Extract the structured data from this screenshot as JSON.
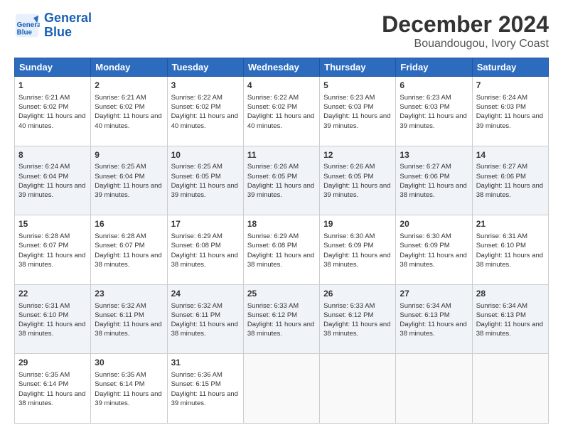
{
  "logo": {
    "line1": "General",
    "line2": "Blue"
  },
  "title": "December 2024",
  "subtitle": "Bouandougou, Ivory Coast",
  "days_header": [
    "Sunday",
    "Monday",
    "Tuesday",
    "Wednesday",
    "Thursday",
    "Friday",
    "Saturday"
  ],
  "weeks": [
    [
      {
        "day": "1",
        "sunrise": "6:21 AM",
        "sunset": "6:02 PM",
        "daylight": "11 hours and 40 minutes."
      },
      {
        "day": "2",
        "sunrise": "6:21 AM",
        "sunset": "6:02 PM",
        "daylight": "11 hours and 40 minutes."
      },
      {
        "day": "3",
        "sunrise": "6:22 AM",
        "sunset": "6:02 PM",
        "daylight": "11 hours and 40 minutes."
      },
      {
        "day": "4",
        "sunrise": "6:22 AM",
        "sunset": "6:02 PM",
        "daylight": "11 hours and 40 minutes."
      },
      {
        "day": "5",
        "sunrise": "6:23 AM",
        "sunset": "6:03 PM",
        "daylight": "11 hours and 39 minutes."
      },
      {
        "day": "6",
        "sunrise": "6:23 AM",
        "sunset": "6:03 PM",
        "daylight": "11 hours and 39 minutes."
      },
      {
        "day": "7",
        "sunrise": "6:24 AM",
        "sunset": "6:03 PM",
        "daylight": "11 hours and 39 minutes."
      }
    ],
    [
      {
        "day": "8",
        "sunrise": "6:24 AM",
        "sunset": "6:04 PM",
        "daylight": "11 hours and 39 minutes."
      },
      {
        "day": "9",
        "sunrise": "6:25 AM",
        "sunset": "6:04 PM",
        "daylight": "11 hours and 39 minutes."
      },
      {
        "day": "10",
        "sunrise": "6:25 AM",
        "sunset": "6:05 PM",
        "daylight": "11 hours and 39 minutes."
      },
      {
        "day": "11",
        "sunrise": "6:26 AM",
        "sunset": "6:05 PM",
        "daylight": "11 hours and 39 minutes."
      },
      {
        "day": "12",
        "sunrise": "6:26 AM",
        "sunset": "6:05 PM",
        "daylight": "11 hours and 39 minutes."
      },
      {
        "day": "13",
        "sunrise": "6:27 AM",
        "sunset": "6:06 PM",
        "daylight": "11 hours and 38 minutes."
      },
      {
        "day": "14",
        "sunrise": "6:27 AM",
        "sunset": "6:06 PM",
        "daylight": "11 hours and 38 minutes."
      }
    ],
    [
      {
        "day": "15",
        "sunrise": "6:28 AM",
        "sunset": "6:07 PM",
        "daylight": "11 hours and 38 minutes."
      },
      {
        "day": "16",
        "sunrise": "6:28 AM",
        "sunset": "6:07 PM",
        "daylight": "11 hours and 38 minutes."
      },
      {
        "day": "17",
        "sunrise": "6:29 AM",
        "sunset": "6:08 PM",
        "daylight": "11 hours and 38 minutes."
      },
      {
        "day": "18",
        "sunrise": "6:29 AM",
        "sunset": "6:08 PM",
        "daylight": "11 hours and 38 minutes."
      },
      {
        "day": "19",
        "sunrise": "6:30 AM",
        "sunset": "6:09 PM",
        "daylight": "11 hours and 38 minutes."
      },
      {
        "day": "20",
        "sunrise": "6:30 AM",
        "sunset": "6:09 PM",
        "daylight": "11 hours and 38 minutes."
      },
      {
        "day": "21",
        "sunrise": "6:31 AM",
        "sunset": "6:10 PM",
        "daylight": "11 hours and 38 minutes."
      }
    ],
    [
      {
        "day": "22",
        "sunrise": "6:31 AM",
        "sunset": "6:10 PM",
        "daylight": "11 hours and 38 minutes."
      },
      {
        "day": "23",
        "sunrise": "6:32 AM",
        "sunset": "6:11 PM",
        "daylight": "11 hours and 38 minutes."
      },
      {
        "day": "24",
        "sunrise": "6:32 AM",
        "sunset": "6:11 PM",
        "daylight": "11 hours and 38 minutes."
      },
      {
        "day": "25",
        "sunrise": "6:33 AM",
        "sunset": "6:12 PM",
        "daylight": "11 hours and 38 minutes."
      },
      {
        "day": "26",
        "sunrise": "6:33 AM",
        "sunset": "6:12 PM",
        "daylight": "11 hours and 38 minutes."
      },
      {
        "day": "27",
        "sunrise": "6:34 AM",
        "sunset": "6:13 PM",
        "daylight": "11 hours and 38 minutes."
      },
      {
        "day": "28",
        "sunrise": "6:34 AM",
        "sunset": "6:13 PM",
        "daylight": "11 hours and 38 minutes."
      }
    ],
    [
      {
        "day": "29",
        "sunrise": "6:35 AM",
        "sunset": "6:14 PM",
        "daylight": "11 hours and 38 minutes."
      },
      {
        "day": "30",
        "sunrise": "6:35 AM",
        "sunset": "6:14 PM",
        "daylight": "11 hours and 39 minutes."
      },
      {
        "day": "31",
        "sunrise": "6:36 AM",
        "sunset": "6:15 PM",
        "daylight": "11 hours and 39 minutes."
      },
      null,
      null,
      null,
      null
    ]
  ]
}
